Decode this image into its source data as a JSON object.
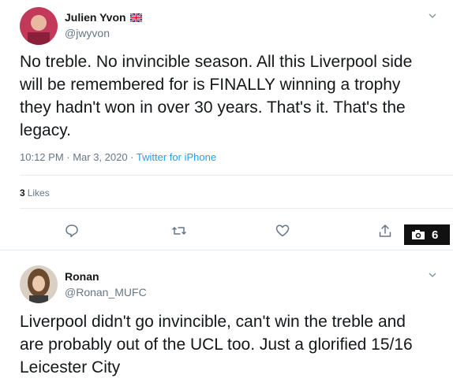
{
  "tweets": [
    {
      "display_name": "Julien Yvon",
      "handle": "@jwyvon",
      "text": "No treble. No invincible season. All this Liverpool side\nwill be remembered for is FINALLY winning a trophy\nthey hadn't won in over 30 years. That's it. That's the\nlegacy.",
      "timestamp": "10:12 PM · Mar 3, 2020 · ",
      "source": "Twitter for iPhone",
      "likes_count": "3",
      "likes_label": "Likes",
      "flag_icon": "uk-flag-icon"
    },
    {
      "display_name": "Ronan",
      "handle": "@Ronan_MUFC",
      "text": "Liverpool didn't go invincible, can't win the treble and\nare probably out of the UCL too. Just a glorified 15/16\nLeicester City"
    }
  ],
  "photo_badge": {
    "count": "6",
    "icon": "camera-icon"
  },
  "colors": {
    "text": "#14171a",
    "secondary": "#657786",
    "link": "#1da1f2",
    "border": "#e1e8ed"
  }
}
